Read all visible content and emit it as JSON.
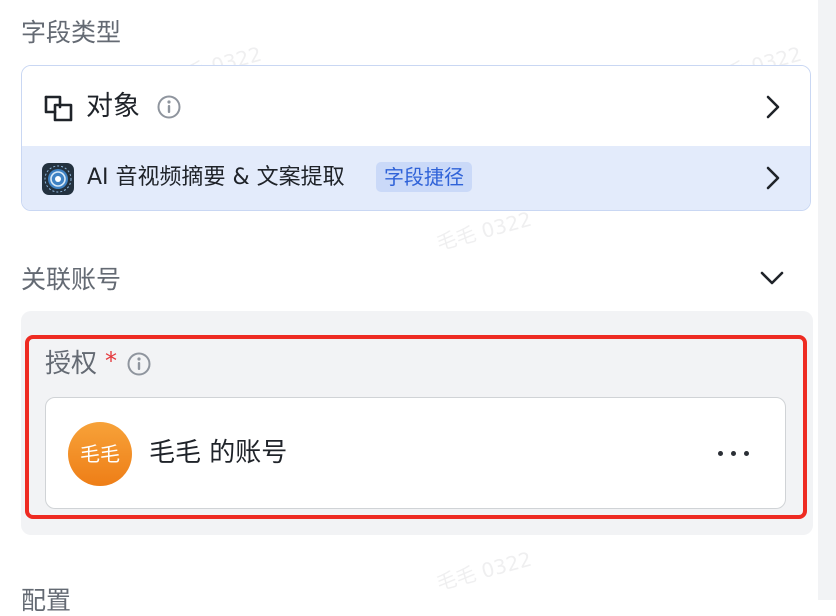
{
  "field_type": {
    "title": "字段类型",
    "object_label": "对象",
    "shortcut_label": "AI 音视频摘要 & 文案提取",
    "shortcut_tag": "字段捷径"
  },
  "linked_account": {
    "title": "关联账号",
    "auth_label": "授权",
    "required_mark": "*",
    "account": {
      "avatar_text": "毛毛",
      "name": "毛毛 的账号"
    }
  },
  "config": {
    "title": "配置"
  },
  "watermark": {
    "text": "毛毛 0322"
  },
  "colors": {
    "accent": "#2f62d8",
    "highlight": "#ee2b22",
    "avatar": "#f29028"
  }
}
